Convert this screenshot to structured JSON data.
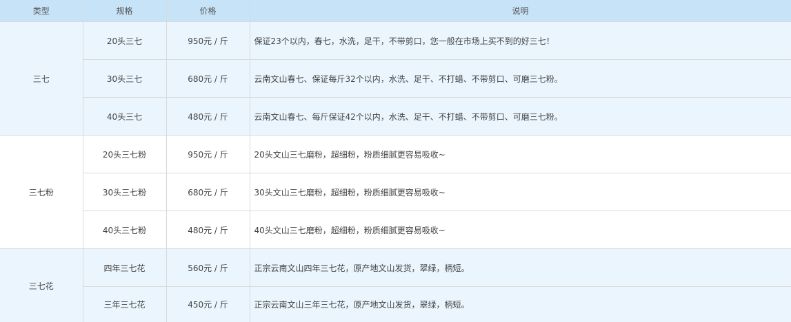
{
  "table": {
    "headers": [
      "类型",
      "规格",
      "价格",
      "说明"
    ],
    "groups": [
      {
        "type": "三七",
        "rows": [
          {
            "spec": "20头三七",
            "price": "950元 / 斤",
            "desc": "保证23个以内，春七，水洗，足干，不带剪口，您一般在市场上买不到的好三七！"
          },
          {
            "spec": "30头三七",
            "price": "680元 / 斤",
            "desc": "云南文山春七、保证每斤32个以内，水洗、足干、不打蜡、不带剪口、可磨三七粉。"
          },
          {
            "spec": "40头三七",
            "price": "480元 / 斤",
            "desc": "云南文山春七、每斤保证42个以内，水洗、足干、不打蜡、不带剪口、可磨三七粉。"
          }
        ]
      },
      {
        "type": "三七粉",
        "rows": [
          {
            "spec": "20头三七粉",
            "price": "950元 / 斤",
            "desc": "20头文山三七磨粉，超细粉，粉质细腻更容易吸收~"
          },
          {
            "spec": "30头三七粉",
            "price": "680元 / 斤",
            "desc": "30头文山三七磨粉，超细粉，粉质细腻更容易吸收~"
          },
          {
            "spec": "40头三七粉",
            "price": "480元 / 斤",
            "desc": "40头文山三七磨粉，超细粉，粉质细腻更容易吸收~"
          }
        ]
      },
      {
        "type": "三七花",
        "rows": [
          {
            "spec": "四年三七花",
            "price": "560元 / 斤",
            "desc": "正宗云南文山四年三七花，原产地文山发货，翠绿，柄短。"
          },
          {
            "spec": "三年三七花",
            "price": "450元 / 斤",
            "desc": "正宗云南文山三年三七花，原产地文山发货，翠绿，柄短。"
          }
        ]
      }
    ]
  }
}
